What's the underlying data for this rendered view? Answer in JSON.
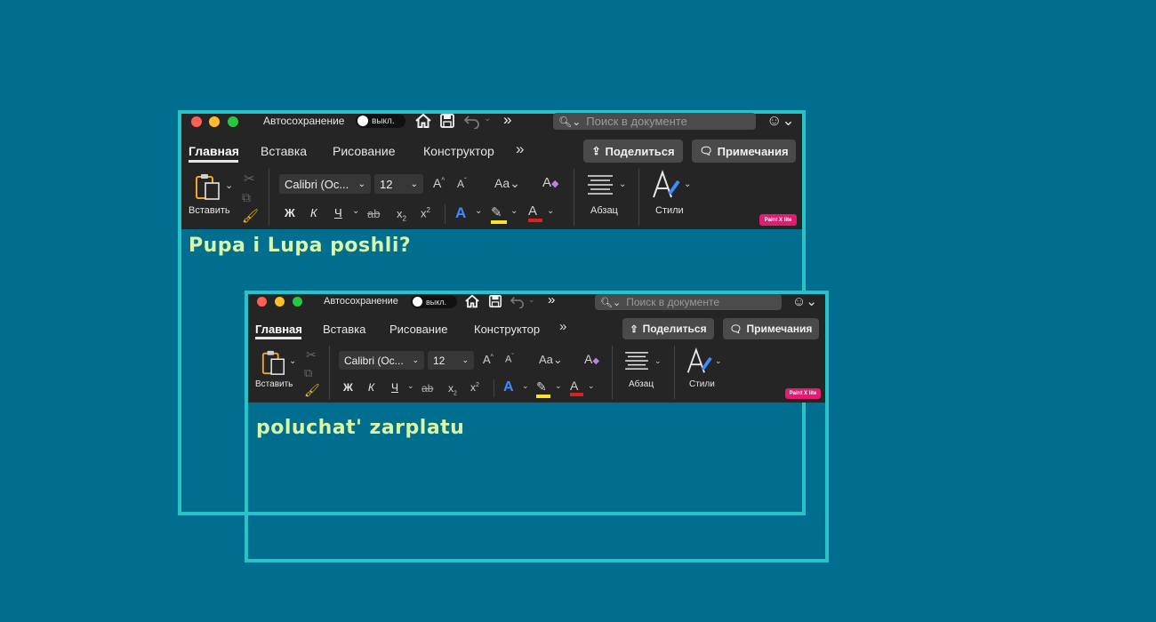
{
  "windows": [
    {
      "titlebar": {
        "autosave_label": "Автосохранение",
        "autosave_state": "выкл.",
        "search_placeholder": "Поиск в документе"
      },
      "tabs": [
        "Главная",
        "Вставка",
        "Рисование",
        "Конструктор"
      ],
      "active_tab": "Главная",
      "share_label": "Поделиться",
      "comments_label": "Примечания",
      "ribbon": {
        "paste_label": "Вставить",
        "font_name": "Calibri (Ос...",
        "font_size": "12",
        "bold": "Ж",
        "italic": "К",
        "underline": "Ч",
        "strike": "ab",
        "paragraph_label": "Абзац",
        "styles_label": "Стили",
        "badge": "Paint X lite"
      },
      "document_text": "Pupa i Lupa poshli?"
    },
    {
      "titlebar": {
        "autosave_label": "Автосохранение",
        "autosave_state": "выкл.",
        "search_placeholder": "Поиск в документе"
      },
      "tabs": [
        "Главная",
        "Вставка",
        "Рисование",
        "Конструктор"
      ],
      "active_tab": "Главная",
      "share_label": "Поделиться",
      "comments_label": "Примечания",
      "ribbon": {
        "paste_label": "Вставить",
        "font_name": "Calibri (Ос...",
        "font_size": "12",
        "bold": "Ж",
        "italic": "К",
        "underline": "Ч",
        "strike": "ab",
        "paragraph_label": "Абзац",
        "styles_label": "Стили",
        "badge": "Paint X lite"
      },
      "document_text": "poluchat' zarplatu"
    }
  ],
  "colors": {
    "background": "#006e8f",
    "frame": "#27c3c6",
    "toolbar": "#252525",
    "document_text": "#d9f5a8",
    "badge": "#e31b73"
  }
}
